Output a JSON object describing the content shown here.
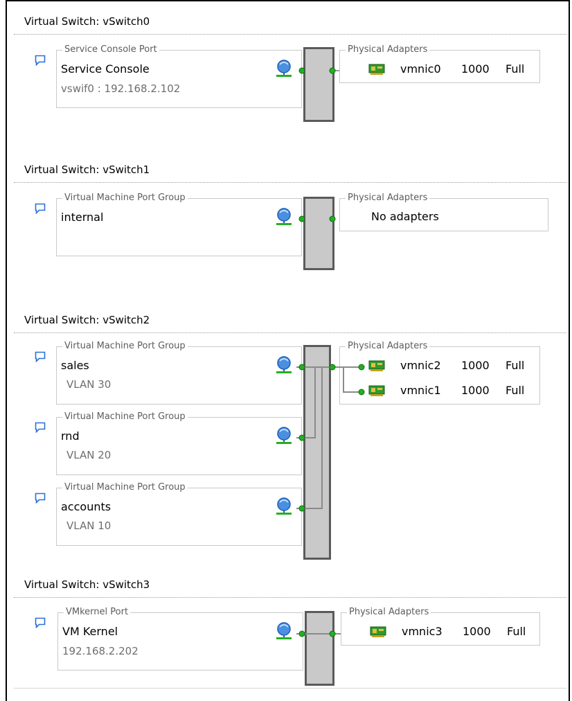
{
  "vswitch0": {
    "title": "Virtual Switch: vSwitch0",
    "portgroup": {
      "legend": "Service Console Port",
      "name": "Service Console",
      "sub": "vswif0 : 192.168.2.102"
    },
    "adapters_legend": "Physical Adapters",
    "adapters": [
      {
        "name": "vmnic0",
        "speed": "1000",
        "duplex": "Full"
      }
    ]
  },
  "vswitch1": {
    "title": "Virtual Switch: vSwitch1",
    "portgroup": {
      "legend": "Virtual Machine Port Group",
      "name": "internal"
    },
    "adapters_legend": "Physical Adapters",
    "no_adapters": "No adapters"
  },
  "vswitch2": {
    "title": "Virtual Switch: vSwitch2",
    "portgroups": [
      {
        "legend": "Virtual Machine Port Group",
        "name": "sales",
        "sub": "VLAN 30"
      },
      {
        "legend": "Virtual Machine Port Group",
        "name": "rnd",
        "sub": "VLAN 20"
      },
      {
        "legend": "Virtual Machine Port Group",
        "name": "accounts",
        "sub": "VLAN 10"
      }
    ],
    "adapters_legend": "Physical Adapters",
    "adapters": [
      {
        "name": "vmnic2",
        "speed": "1000",
        "duplex": "Full"
      },
      {
        "name": "vmnic1",
        "speed": "1000",
        "duplex": "Full"
      }
    ]
  },
  "vswitch3": {
    "title": "Virtual Switch: vSwitch3",
    "portgroup": {
      "legend": "VMkernel Port",
      "name": "VM Kernel",
      "sub": "192.168.2.202"
    },
    "adapters_legend": "Physical Adapters",
    "adapters": [
      {
        "name": "vmnic3",
        "speed": "1000",
        "duplex": "Full"
      }
    ]
  },
  "icons": {
    "comment": "comment-bubble-icon",
    "network": "network-globe-icon",
    "nic": "network-card-icon"
  },
  "colors": {
    "accent_blue": "#2a6fd6",
    "connector_green": "#22b022",
    "wire_gray": "#9a9a9a",
    "switch_fill": "#c9c9c9",
    "switch_border": "#5a5a5a"
  }
}
